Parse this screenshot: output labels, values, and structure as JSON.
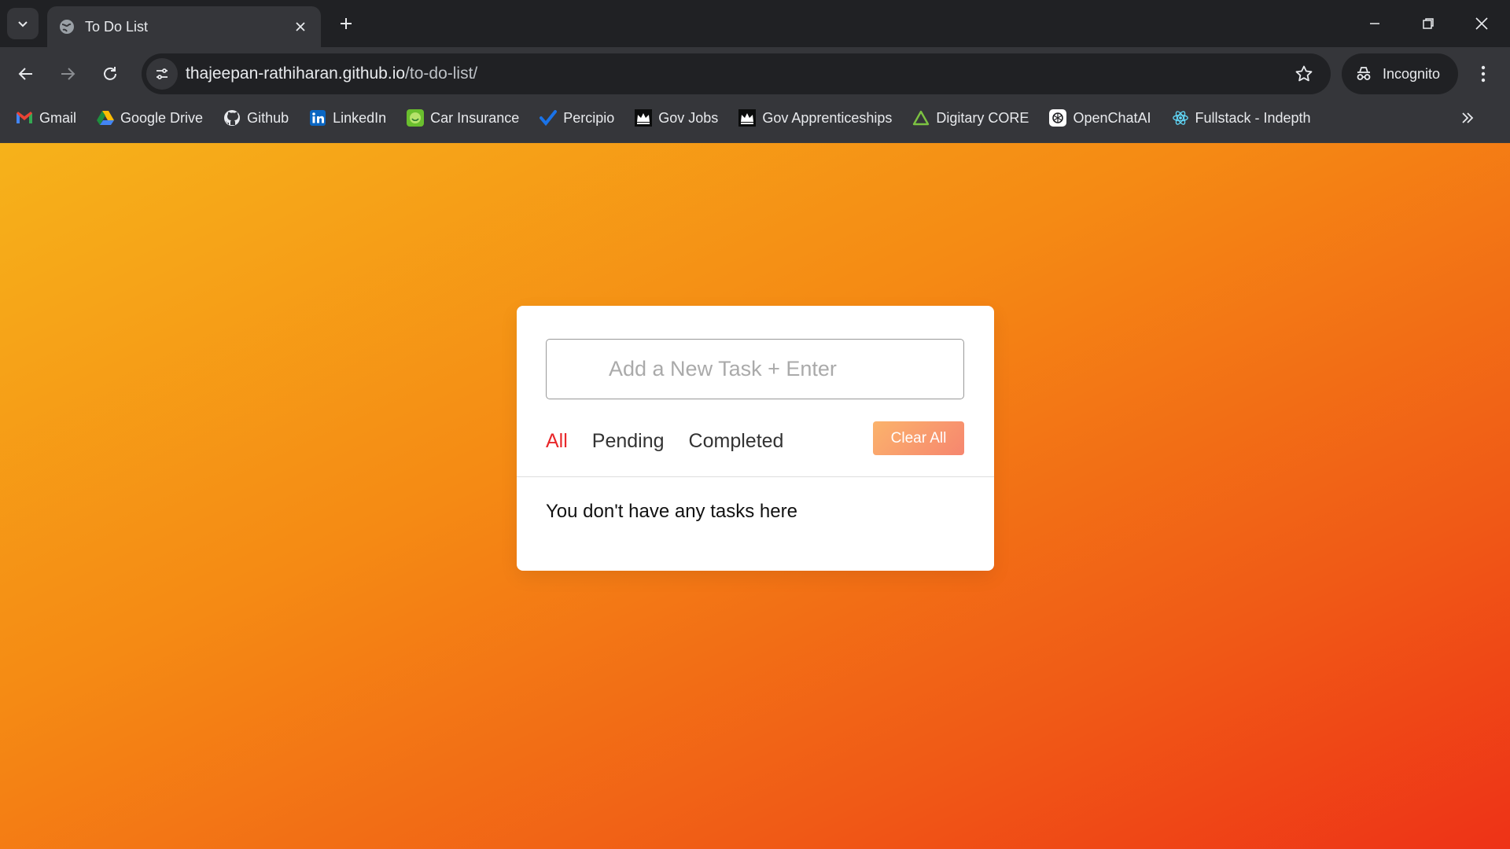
{
  "browser": {
    "tab": {
      "title": "To Do List"
    },
    "address": {
      "host": "thajeepan-rathiharan.github.io",
      "path": "/to-do-list/"
    },
    "profile_label": "Incognito",
    "bookmarks": [
      {
        "label": "Gmail",
        "icon": "gmail-icon"
      },
      {
        "label": "Google Drive",
        "icon": "google-drive-icon"
      },
      {
        "label": "Github",
        "icon": "github-icon"
      },
      {
        "label": "LinkedIn",
        "icon": "linkedin-icon"
      },
      {
        "label": "Car Insurance",
        "icon": "car-insurance-icon"
      },
      {
        "label": "Percipio",
        "icon": "percipio-icon"
      },
      {
        "label": "Gov Jobs",
        "icon": "crown-icon"
      },
      {
        "label": "Gov Apprenticeships",
        "icon": "crown-icon"
      },
      {
        "label": "Digitary CORE",
        "icon": "triangle-icon"
      },
      {
        "label": "OpenChatAI",
        "icon": "openai-icon"
      },
      {
        "label": "Fullstack - Indepth",
        "icon": "react-icon"
      }
    ]
  },
  "todo": {
    "input": {
      "placeholder": "Add a New Task + Enter",
      "value": ""
    },
    "filters": [
      {
        "label": "All",
        "active": true
      },
      {
        "label": "Pending",
        "active": false
      },
      {
        "label": "Completed",
        "active": false
      }
    ],
    "clear_label": "Clear All",
    "empty_message": "You don't have any tasks here"
  },
  "colors": {
    "active_filter": "#e8272a",
    "gradient_start": "#f6b21a",
    "gradient_end": "#ee3217"
  }
}
